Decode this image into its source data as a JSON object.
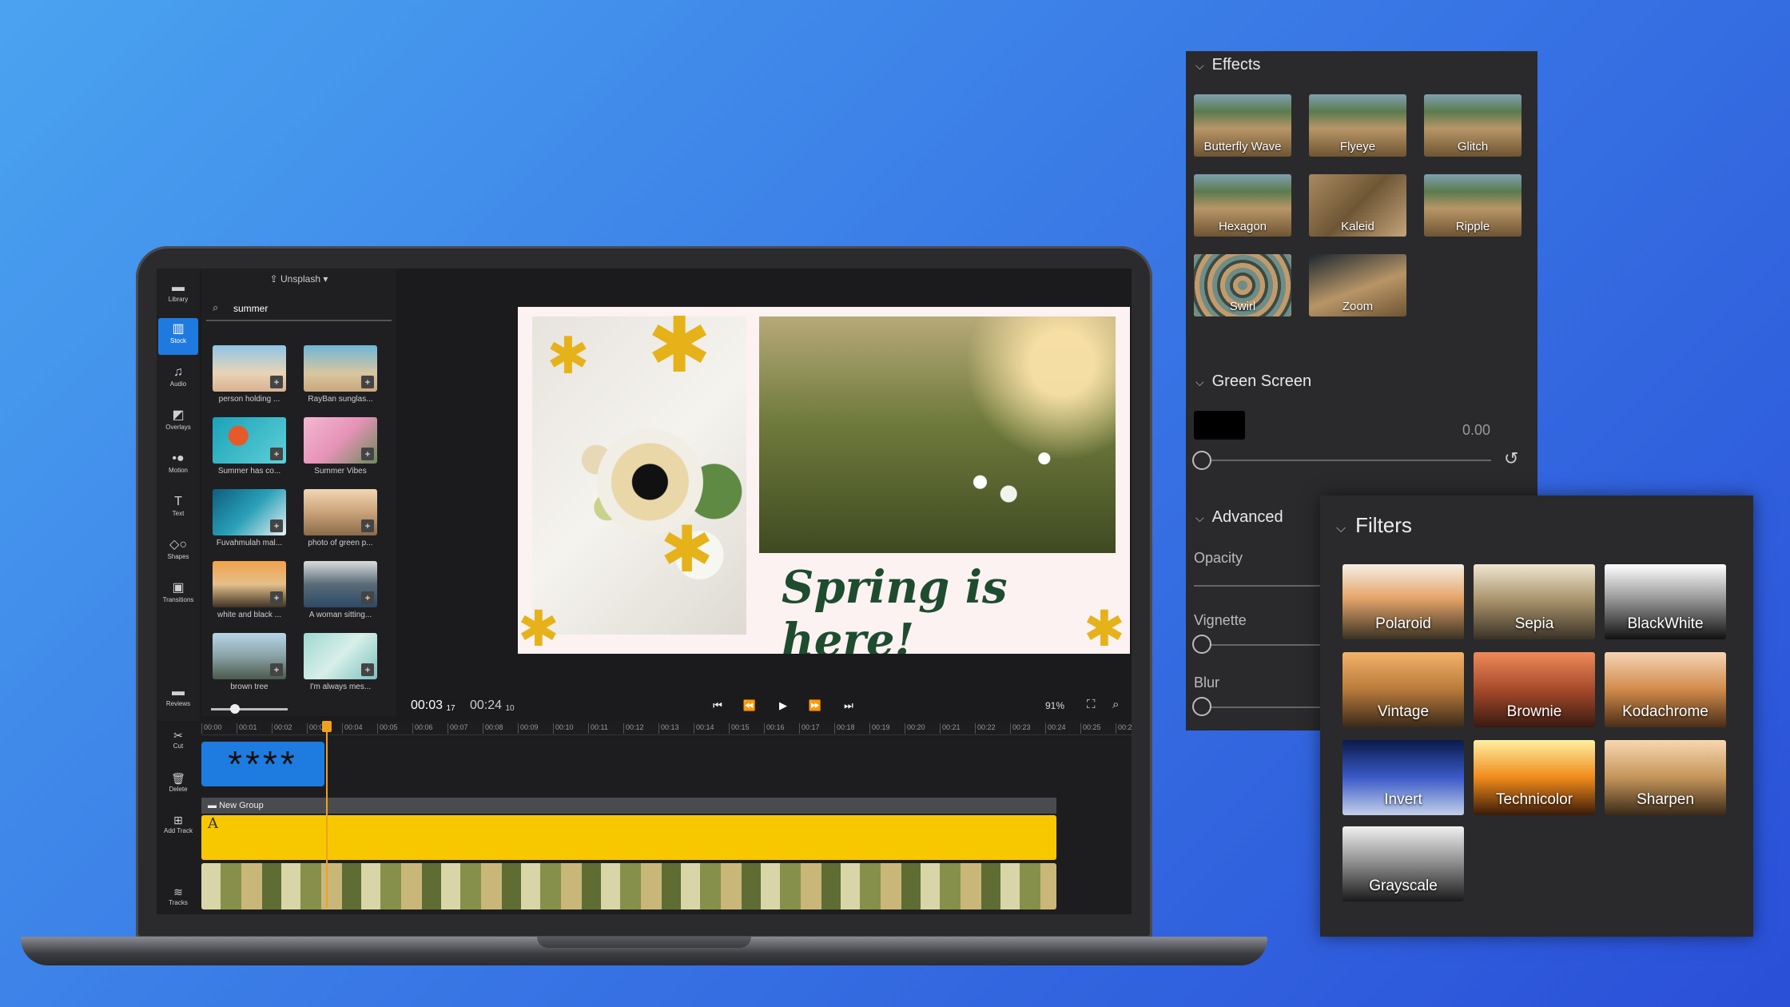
{
  "editor": {
    "rail": {
      "library": "Library",
      "stock": "Stock",
      "audio": "Audio",
      "overlays": "Overlays",
      "motion": "Motion",
      "text": "Text",
      "shapes": "Shapes",
      "transitions": "Transitions",
      "reviews": "Reviews"
    },
    "stock": {
      "source": "Unsplash",
      "query": "summer",
      "items": [
        {
          "caption": "person holding ..."
        },
        {
          "caption": "RayBan sunglas..."
        },
        {
          "caption": "Summer has co..."
        },
        {
          "caption": "Summer Vibes"
        },
        {
          "caption": "Fuvahmulah mal..."
        },
        {
          "caption": "photo of green p..."
        },
        {
          "caption": "white and black ..."
        },
        {
          "caption": "A woman sitting..."
        },
        {
          "caption": "brown tree"
        },
        {
          "caption": "I'm always mes..."
        }
      ]
    },
    "preview": {
      "headline": "Spring is here!",
      "star_color": "#e6b21a",
      "text_color": "#1e4c2e"
    },
    "transport": {
      "current": "00:03",
      "current_frames": "17",
      "total": "00:24",
      "total_frames": "10",
      "zoom": "91%"
    },
    "timeline": {
      "ticks": [
        "00:00",
        "00:01",
        "00:02",
        "00:03",
        "00:04",
        "00:05",
        "00:06",
        "00:07",
        "00:08",
        "00:09",
        "00:10",
        "00:11",
        "00:12",
        "00:13",
        "00:14",
        "00:15",
        "00:16",
        "00:17",
        "00:18",
        "00:19",
        "00:20",
        "00:21",
        "00:22",
        "00:23",
        "00:24",
        "00:25",
        "00:2"
      ],
      "group_label": "New Group",
      "text_clip_marker": "A",
      "stars_clip": "****",
      "tools": {
        "cut": "Cut",
        "delete": "Delete",
        "add_track": "Add Track",
        "tracks": "Tracks"
      }
    }
  },
  "effects": {
    "title": "Effects",
    "items": [
      "Butterfly Wave",
      "Flyeye",
      "Glitch",
      "Hexagon",
      "Kaleid",
      "Ripple",
      "Swirl",
      "Zoom"
    ],
    "green_screen": {
      "title": "Green Screen",
      "value": "0.00",
      "color": "#000000"
    },
    "advanced": {
      "title": "Advanced",
      "opacity": "Opacity",
      "vignette": "Vignette",
      "blur": "Blur"
    }
  },
  "filters": {
    "title": "Filters",
    "items": [
      "Polaroid",
      "Sepia",
      "BlackWhite",
      "Vintage",
      "Brownie",
      "Kodachrome",
      "Invert",
      "Technicolor",
      "Sharpen",
      "Grayscale"
    ]
  },
  "colors": {
    "accent": "#1e7ce0",
    "clip_yellow": "#f7c700",
    "playhead": "#f0a020"
  }
}
